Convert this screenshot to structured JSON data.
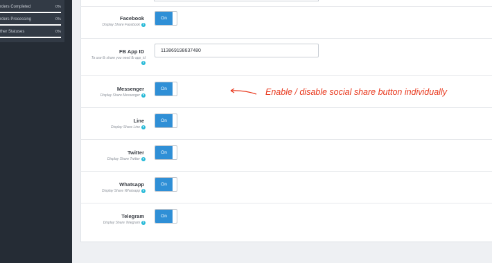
{
  "sidebar": {
    "stats": [
      {
        "label": "rders Completed",
        "value": "0%",
        "fill": 1.0
      },
      {
        "label": "rders Processing",
        "value": "0%",
        "fill": 1.0
      },
      {
        "label": "ther Statuses",
        "value": "0%",
        "fill": 1.0
      }
    ]
  },
  "settings": [
    {
      "label": "Facebook",
      "help": "Display Share Facebook",
      "value": "On"
    },
    {
      "label": "FB App ID",
      "help": "To use fb share you need fb app_id",
      "input_value": "113869198637480"
    },
    {
      "label": "Messenger",
      "help": "Display Share Messenger",
      "value": "On"
    },
    {
      "label": "Line",
      "help": "Display Share Line",
      "value": "On"
    },
    {
      "label": "Twitter",
      "help": "Display Share Twitter",
      "value": "On"
    },
    {
      "label": "Whatsapp",
      "help": "Display Share Whatsapp",
      "value": "On"
    },
    {
      "label": "Telegram",
      "help": "Display Share Telegram",
      "value": "On"
    }
  ],
  "annotation": {
    "text": "Enable / disable social share button individually",
    "color": "#e8381d"
  },
  "colors": {
    "toggle_on": "#2f8fd6",
    "help_icon": "#25b9d7",
    "sidebar_bg": "#252c35"
  },
  "icons": {
    "help": "question-circle-icon",
    "annotation_arrow": "left-arrow-icon"
  }
}
